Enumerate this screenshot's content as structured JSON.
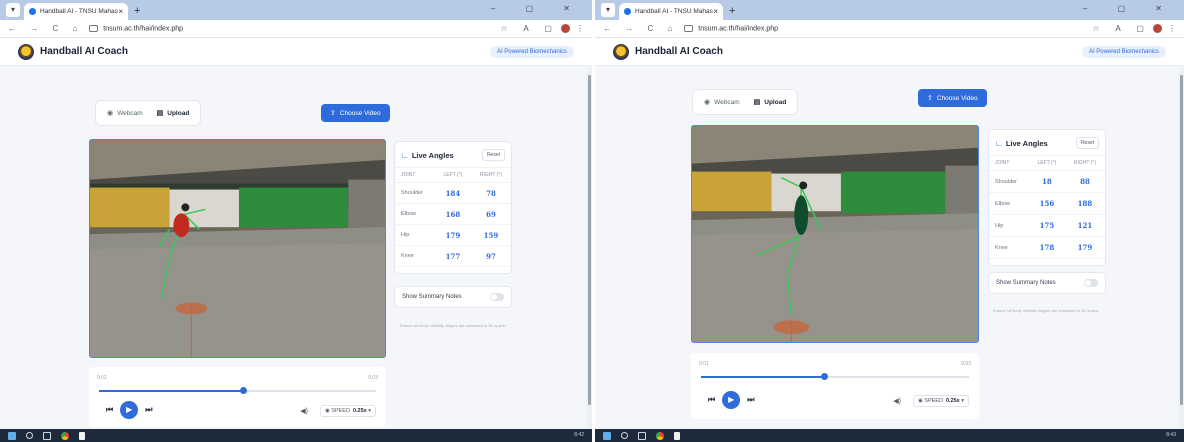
{
  "browser": {
    "tab_title": "Handball AI - TNSU Mahasara",
    "url": "tnsum.ac.th/hai/index.php",
    "new_tab": "+",
    "window_controls": "– ▢ ✕"
  },
  "app": {
    "title": "Handball AI Coach",
    "badge": "AI Powered Biomechanics"
  },
  "modes": {
    "webcam": "Webcam",
    "upload": "Upload"
  },
  "choose_video": "Choose Video",
  "angles": {
    "title": "Live Angles",
    "reset": "Reset",
    "headers": [
      "JOINT",
      "LEFT (°)",
      "RIGHT (°)"
    ],
    "notes_label": "Show Summary Notes",
    "hint": "Ensure full body visibility. Angles are estimated in 2D space."
  },
  "panels": [
    {
      "time_start": "0:02",
      "time_end": "0:03",
      "progress": 0.5,
      "speed_label": "SPEED",
      "speed_value": "0.25x",
      "rows": [
        {
          "joint": "Shoulder",
          "left": "184",
          "right": "78"
        },
        {
          "joint": "Elbow",
          "left": "168",
          "right": "69"
        },
        {
          "joint": "Hip",
          "left": "179",
          "right": "159"
        },
        {
          "joint": "Knee",
          "left": "177",
          "right": "97"
        }
      ],
      "clock": "8:42"
    },
    {
      "time_start": "0:01",
      "time_end": "0:03",
      "progress": 0.45,
      "speed_label": "SPEED",
      "speed_value": "0.25x",
      "rows": [
        {
          "joint": "Shoulder",
          "left": "18",
          "right": "88"
        },
        {
          "joint": "Elbow",
          "left": "156",
          "right": "188"
        },
        {
          "joint": "Hip",
          "left": "175",
          "right": "121"
        },
        {
          "joint": "Knee",
          "left": "178",
          "right": "179"
        }
      ],
      "clock": "8:43"
    }
  ],
  "icons": {
    "webcam": "camera-icon",
    "upload": "file-icon",
    "choose": "upload-icon",
    "angles": "angle-icon",
    "volume": "volume-icon",
    "speed": "gauge-icon"
  },
  "colors": {
    "accent": "#2f6bdb",
    "tabbar": "#b7cbe6",
    "taskbar": "#1d2a3c"
  }
}
